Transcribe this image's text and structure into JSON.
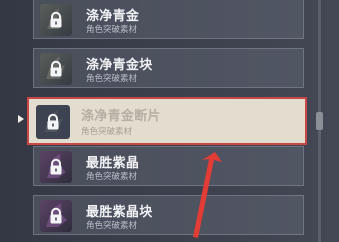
{
  "materials": [
    {
      "name": "涤净青金",
      "subtitle": "角色突破素材",
      "icon": "lock-icon",
      "variant": "gold"
    },
    {
      "name": "涤净青金块",
      "subtitle": "角色突破素材",
      "icon": "lock-icon",
      "variant": "gold"
    },
    {
      "name": "涤净青金断片",
      "subtitle": "角色突破素材",
      "icon": "lock-icon",
      "variant": "gold"
    },
    {
      "name": "最胜紫晶",
      "subtitle": "角色突破素材",
      "icon": "lock-icon",
      "variant": "purple"
    },
    {
      "name": "最胜紫晶块",
      "subtitle": "角色突破素材",
      "icon": "lock-icon",
      "variant": "purple"
    }
  ],
  "selected_index": 2,
  "colors": {
    "selected_background": "#e3ddd0",
    "selection_border": "#c94845",
    "annotation_arrow": "#e13c35",
    "row_background": "#6c7280"
  }
}
